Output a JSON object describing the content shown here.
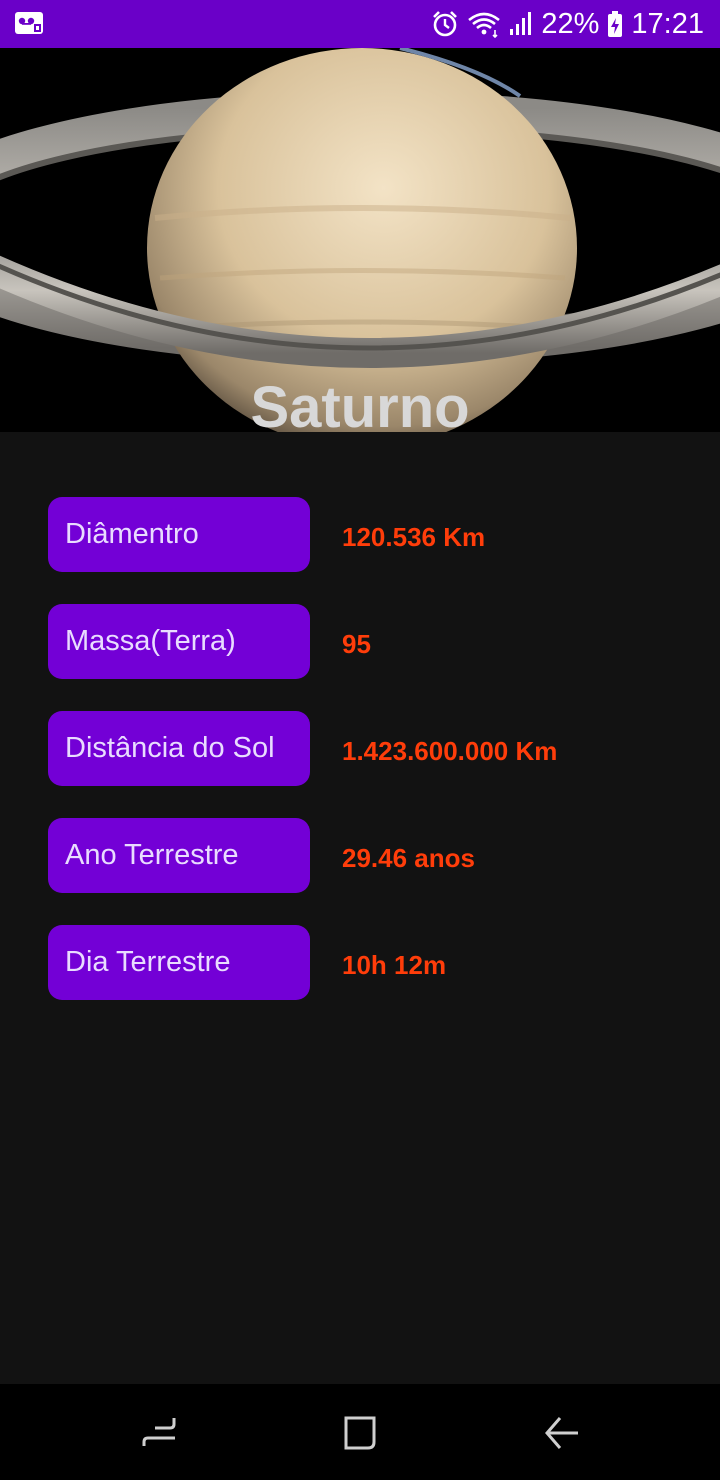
{
  "status_bar": {
    "battery": "22%",
    "time": "17:21",
    "icons": [
      "voicemail-icon",
      "alarm-icon",
      "wifi-icon",
      "signal-icon",
      "battery-charging-icon"
    ]
  },
  "planet": {
    "title": "Saturno"
  },
  "facts": [
    {
      "label": "Diâmentro",
      "value": "120.536 Km"
    },
    {
      "label": "Massa(Terra)",
      "value": "95"
    },
    {
      "label": "Distância do Sol",
      "value": "1.423.600.000 Km"
    },
    {
      "label": "Ano Terrestre",
      "value": "29.46 anos"
    },
    {
      "label": "Dia Terrestre",
      "value": "10h 12m"
    }
  ],
  "nav_bar": {
    "icons": [
      "recents-icon",
      "home-icon",
      "back-icon"
    ]
  },
  "colors": {
    "status_bar": "#6a00c8",
    "label_button": "#7300d6",
    "value_text": "#ff3d0a",
    "background": "#121212"
  }
}
